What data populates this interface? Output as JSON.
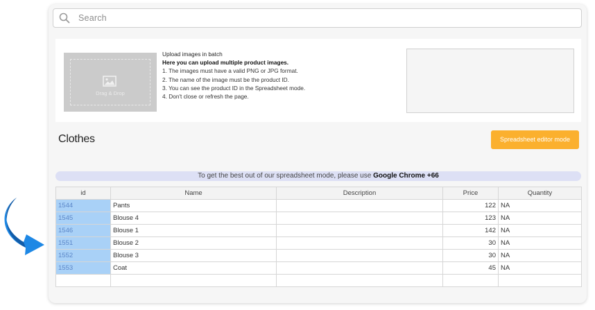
{
  "search": {
    "placeholder": "Search"
  },
  "upload": {
    "dropzone_label": "Drag & Drop",
    "heading": "Upload images in batch",
    "subheading": "Here you can upload multiple product images.",
    "rules": [
      "1. The images must have a valid PNG or JPG format.",
      "2. The name of the image must be the product ID.",
      "3. You can see the product ID in the Spreadsheet mode.",
      "4. Don't close or refresh the page."
    ]
  },
  "page": {
    "title": "Clothes",
    "spreadsheet_button": "Spreadsheet editor mode"
  },
  "banner": {
    "text": "To get the best out of our spreadsheet mode, please use ",
    "highlight": "Google Chrome +66"
  },
  "table": {
    "headers": [
      "id",
      "Name",
      "Description",
      "Price",
      "Quantity"
    ],
    "rows": [
      {
        "id": "1544",
        "name": "Pants",
        "description": "",
        "price": "122",
        "quantity": "NA"
      },
      {
        "id": "1545",
        "name": "Blouse 4",
        "description": "",
        "price": "123",
        "quantity": "NA"
      },
      {
        "id": "1546",
        "name": "Blouse 1",
        "description": "",
        "price": "142",
        "quantity": "NA"
      },
      {
        "id": "1551",
        "name": "Blouse 2",
        "description": "",
        "price": "30",
        "quantity": "NA"
      },
      {
        "id": "1552",
        "name": "Blouse 3",
        "description": "",
        "price": "30",
        "quantity": "NA"
      },
      {
        "id": "1553",
        "name": "Coat",
        "description": "",
        "price": "45",
        "quantity": "NA"
      },
      {
        "id": "",
        "name": "",
        "description": "",
        "price": "",
        "quantity": ""
      }
    ]
  },
  "colors": {
    "accent_button": "#fbb02e",
    "id_cell": "#a9d1f7",
    "banner": "#dde0f5",
    "arrow": "#1e88e5"
  }
}
